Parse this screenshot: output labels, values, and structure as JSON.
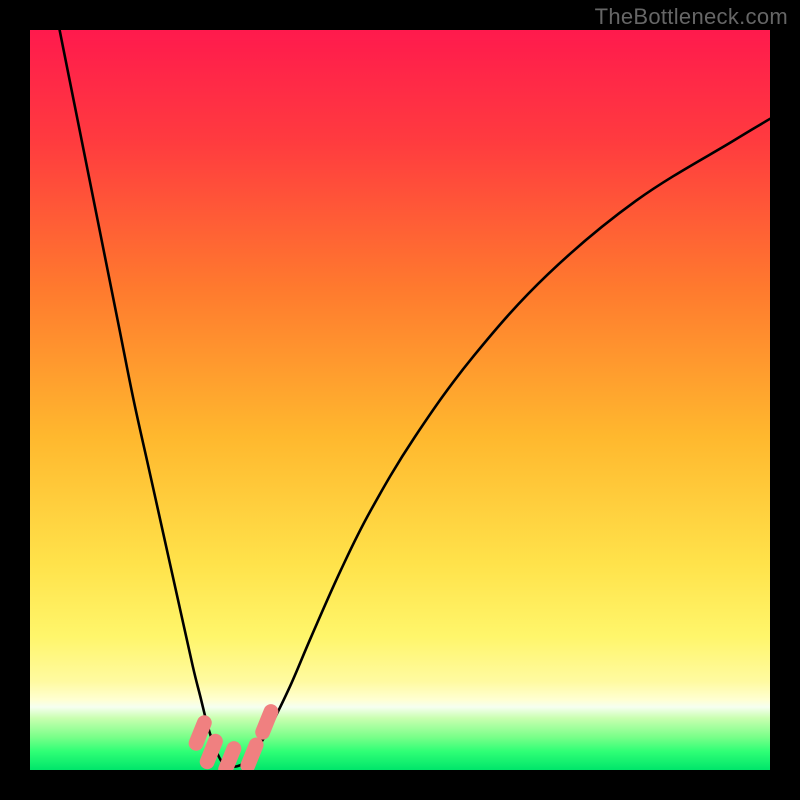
{
  "watermark": "TheBottleneck.com",
  "chart_data": {
    "type": "line",
    "title": "",
    "xlabel": "",
    "ylabel": "",
    "xlim": [
      0,
      100
    ],
    "ylim": [
      0,
      100
    ],
    "grid": false,
    "legend": false,
    "background_gradient_stops": [
      {
        "offset": 0.0,
        "color": "#ff1a4d"
      },
      {
        "offset": 0.15,
        "color": "#ff3b3f"
      },
      {
        "offset": 0.35,
        "color": "#ff7a2e"
      },
      {
        "offset": 0.55,
        "color": "#ffb82e"
      },
      {
        "offset": 0.72,
        "color": "#ffe24a"
      },
      {
        "offset": 0.82,
        "color": "#fff66b"
      },
      {
        "offset": 0.88,
        "color": "#fffaa0"
      },
      {
        "offset": 0.905,
        "color": "#ffffd2"
      },
      {
        "offset": 0.915,
        "color": "#f5fff0"
      },
      {
        "offset": 0.93,
        "color": "#c9ffb0"
      },
      {
        "offset": 0.955,
        "color": "#7bff8a"
      },
      {
        "offset": 0.975,
        "color": "#2fff76"
      },
      {
        "offset": 1.0,
        "color": "#00e56a"
      }
    ],
    "series": [
      {
        "name": "bottleneck-curve",
        "color": "#000000",
        "x": [
          4,
          6,
          8,
          10,
          12,
          14,
          16,
          18,
          20,
          22,
          23,
          24,
          25,
          26,
          27,
          28,
          29,
          30,
          32,
          35,
          38,
          42,
          46,
          52,
          60,
          70,
          82,
          95,
          100
        ],
        "y": [
          100,
          90,
          80,
          70,
          60,
          50,
          41,
          32,
          23,
          14,
          10,
          6,
          3,
          1,
          0.5,
          0.5,
          1,
          2,
          5,
          11,
          18,
          27,
          35,
          45,
          56,
          67,
          77,
          85,
          88
        ]
      }
    ],
    "markers": [
      {
        "name": "optimum-marker",
        "x": 23.0,
        "y": 5.0,
        "color": "#f08080"
      },
      {
        "name": "optimum-marker",
        "x": 24.5,
        "y": 2.5,
        "color": "#f08080"
      },
      {
        "name": "optimum-marker",
        "x": 27.0,
        "y": 1.5,
        "color": "#f08080"
      },
      {
        "name": "optimum-marker",
        "x": 30.0,
        "y": 2.0,
        "color": "#f08080"
      },
      {
        "name": "optimum-marker",
        "x": 32.0,
        "y": 6.5,
        "color": "#f08080"
      }
    ],
    "marker_size": 2.0
  }
}
